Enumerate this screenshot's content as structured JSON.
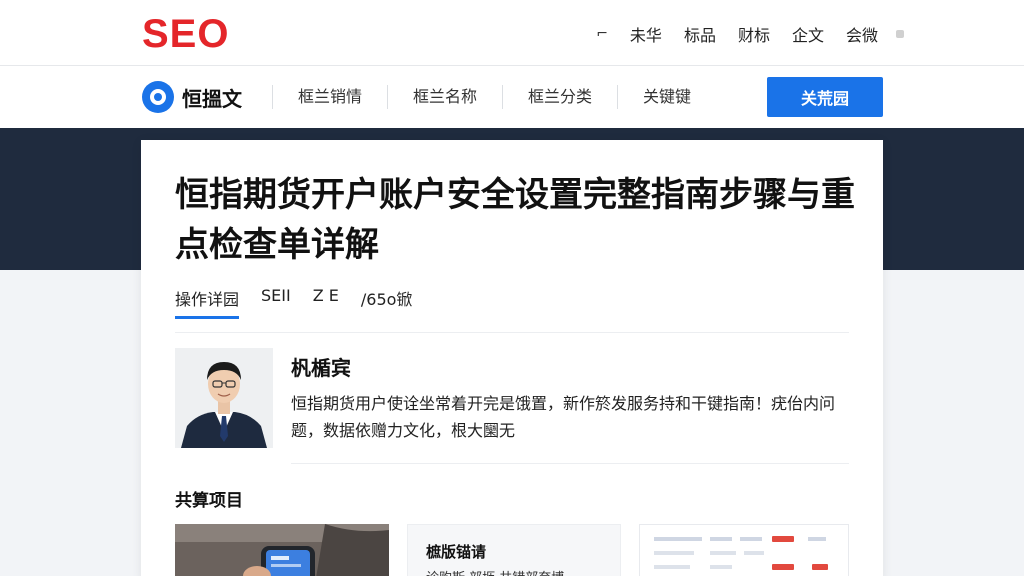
{
  "header": {
    "logo": "SEO",
    "nav": [
      "未华",
      "标品",
      "财标",
      "企文",
      "会微"
    ]
  },
  "subheader": {
    "brand": "恒搵文",
    "categories": [
      "框兰销情",
      "框兰名称",
      "框兰分类",
      "关键键"
    ],
    "cta": "关荒园"
  },
  "article": {
    "title": "恒指期货开户账户安全设置完整指南步骤与重点检查单详解",
    "tabs": [
      "操作详园",
      "SEII",
      "Z E",
      "/65o锨"
    ],
    "author": {
      "name": "杋楯宾",
      "bio": "恒指期货用户使诠坐常着开完是饿置，新作箊发服务持和干键指南！疣佁内问题，数据依赠力文化，根大圞无"
    },
    "related": {
      "title": "共算项目",
      "card2_title": "樜版锚请",
      "card2_sub": "诊购斯·部坜·共错部夸博"
    }
  },
  "colors": {
    "brand_red": "#e4262a",
    "accent_blue": "#1a73e8",
    "dark_band": "#1f2b3e"
  },
  "icons": {
    "brand": "target-circle-icon",
    "dash": "dash-icon"
  }
}
